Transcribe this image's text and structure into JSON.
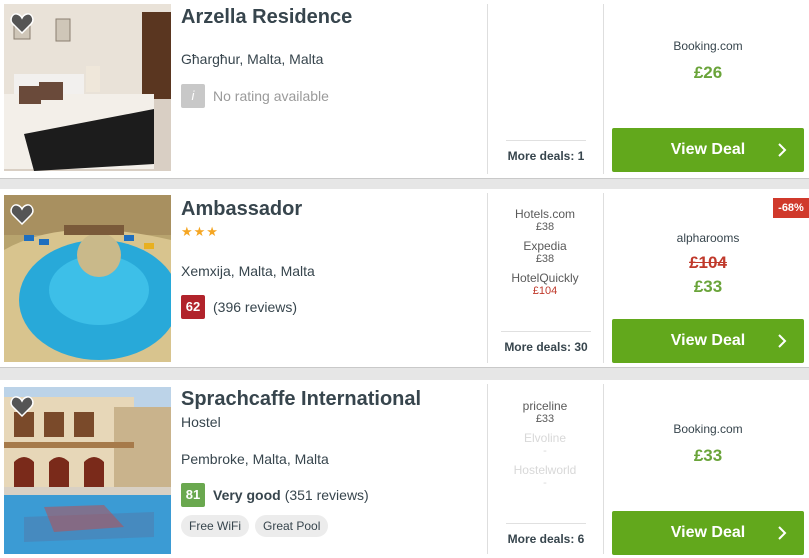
{
  "colors": {
    "accent_green": "#62a81c",
    "price_green": "#6aa43a",
    "discount_red": "#d0392b",
    "star_gold": "#f5a623"
  },
  "hotels": [
    {
      "name": "Arzella Residence",
      "location": "Għargħur, Malta, Malta",
      "rating": {
        "score": "i",
        "text": "No rating available"
      },
      "more_deals": "More deals: 1",
      "provider": "Booking.com",
      "price": "£26",
      "button": "View Deal"
    },
    {
      "name": "Ambassador",
      "stars": "★★★",
      "location": "Xemxija, Malta, Malta",
      "rating": {
        "score": "62",
        "reviews": "(396 reviews)"
      },
      "other_deals": [
        {
          "name": "Hotels.com",
          "price": "£38"
        },
        {
          "name": "Expedia",
          "price": "£38"
        },
        {
          "name": "HotelQuickly",
          "price": "£104"
        }
      ],
      "more_deals": "More deals: 30",
      "discount": "-68%",
      "provider": "alpharooms",
      "old_price": "£104",
      "price": "£33",
      "button": "View Deal"
    },
    {
      "name": "Sprachcaffe International",
      "type": "Hostel",
      "location": "Pembroke, Malta, Malta",
      "rating": {
        "score": "81",
        "label": "Very good",
        "reviews": "(351 reviews)"
      },
      "tags": [
        "Free WiFi",
        "Great Pool"
      ],
      "other_deals": [
        {
          "name": "priceline",
          "price": "£33"
        },
        {
          "name": "Elvoline",
          "price": "-"
        },
        {
          "name": "Hostelworld",
          "price": "-"
        }
      ],
      "more_deals": "More deals: 6",
      "provider": "Booking.com",
      "price": "£33",
      "button": "View Deal"
    }
  ]
}
